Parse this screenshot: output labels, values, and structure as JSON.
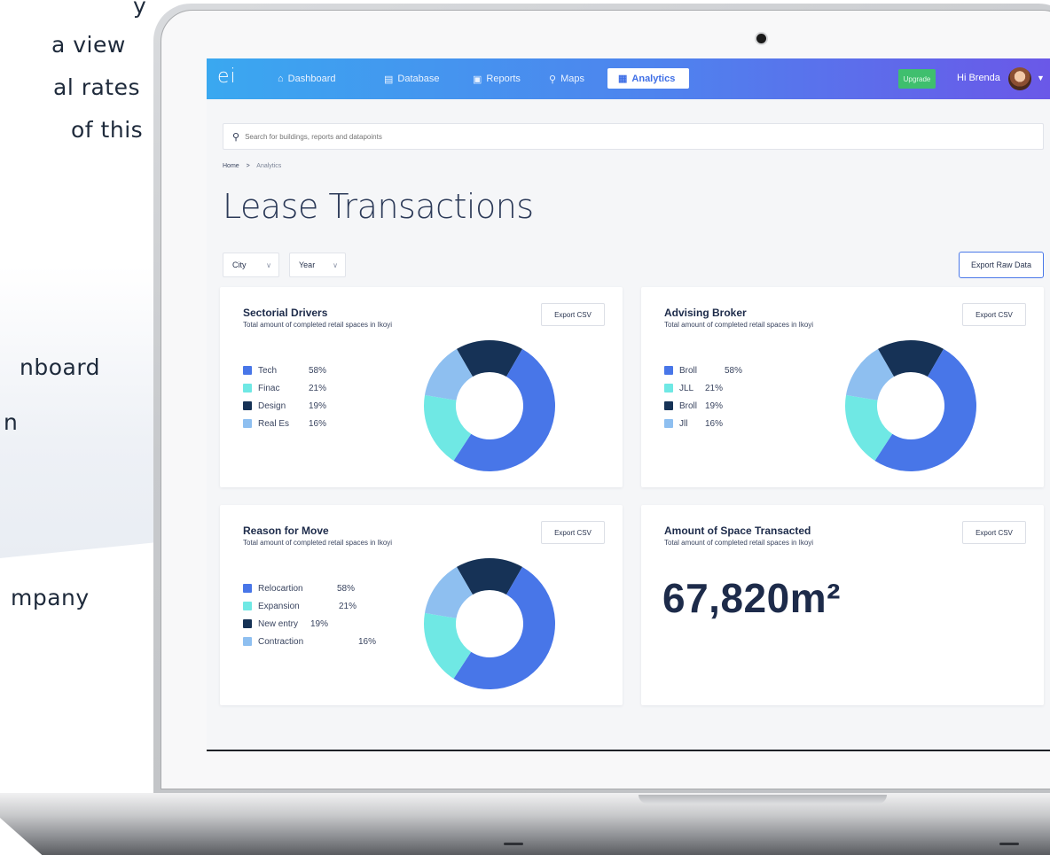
{
  "background": {
    "fragments": [
      "y",
      "a view",
      "al rates",
      "of this",
      "nboard",
      "n",
      "mpany"
    ]
  },
  "app": {
    "logo": "ei",
    "nav": [
      {
        "label": "Dashboard",
        "icon": "home-icon"
      },
      {
        "label": "Database",
        "icon": "document-icon"
      },
      {
        "label": "Reports",
        "icon": "report-icon"
      },
      {
        "label": "Maps",
        "icon": "map-icon"
      },
      {
        "label": "Analytics",
        "icon": "analytics-icon",
        "active": true
      }
    ],
    "upgrade_label": "Upgrade",
    "greeting": "Hi Brenda"
  },
  "search": {
    "placeholder": "Search for buildings, reports and datapoints"
  },
  "breadcrumb": {
    "home": "Home",
    "separator": ">",
    "current": "Analytics"
  },
  "page": {
    "title": "Lease Transactions",
    "filters": [
      "City",
      "Year"
    ],
    "export_raw_label": "Export Raw Data"
  },
  "colors": {
    "blue": "#4876e8",
    "cyan": "#6fe8e4",
    "navy": "#163256",
    "lightblue": "#8ebff0"
  },
  "cards": [
    {
      "title": "Sectorial Drivers",
      "subtitle": "Total amount of completed retail spaces in Ikoyi",
      "export_label": "Export CSV",
      "legend": [
        {
          "label": "Tech",
          "value": "58%"
        },
        {
          "label": "Finac",
          "value": "21%"
        },
        {
          "label": "Design",
          "value": "19%"
        },
        {
          "label": "Real Es",
          "value": "16%"
        }
      ]
    },
    {
      "title": "Advising Broker",
      "subtitle": "Total amount of completed retail spaces in Ikoyi",
      "export_label": "Export CSV",
      "legend": [
        {
          "label": "Broll",
          "value": "58%"
        },
        {
          "label": "JLL",
          "value": "21%"
        },
        {
          "label": "Broll",
          "value": "19%"
        },
        {
          "label": "Jll",
          "value": "16%"
        }
      ]
    },
    {
      "title": "Reason for Move",
      "subtitle": "Total amount of completed retail spaces in Ikoyi",
      "export_label": "Export CSV",
      "legend": [
        {
          "label": "Relocartion",
          "value": "58%"
        },
        {
          "label": "Expansion",
          "value": "21%"
        },
        {
          "label": "New entry",
          "value": "19%"
        },
        {
          "label": "Contraction",
          "value": "16%"
        }
      ]
    },
    {
      "title": "Amount of Space Transacted",
      "subtitle": "Total amount of completed retail spaces in Ikoyi",
      "export_label": "Export CSV",
      "value": "67,820m²"
    }
  ],
  "chart_data": [
    {
      "type": "pie",
      "categories": [
        "Tech",
        "Finac",
        "Design",
        "Real Es"
      ],
      "values": [
        58,
        21,
        19,
        16
      ],
      "title": "Sectorial Drivers"
    },
    {
      "type": "pie",
      "categories": [
        "Broll",
        "JLL",
        "Broll",
        "Jll"
      ],
      "values": [
        58,
        21,
        19,
        16
      ],
      "title": "Advising Broker"
    },
    {
      "type": "pie",
      "categories": [
        "Relocartion",
        "Expansion",
        "New entry",
        "Contraction"
      ],
      "values": [
        58,
        21,
        19,
        16
      ],
      "title": "Reason for Move"
    }
  ]
}
